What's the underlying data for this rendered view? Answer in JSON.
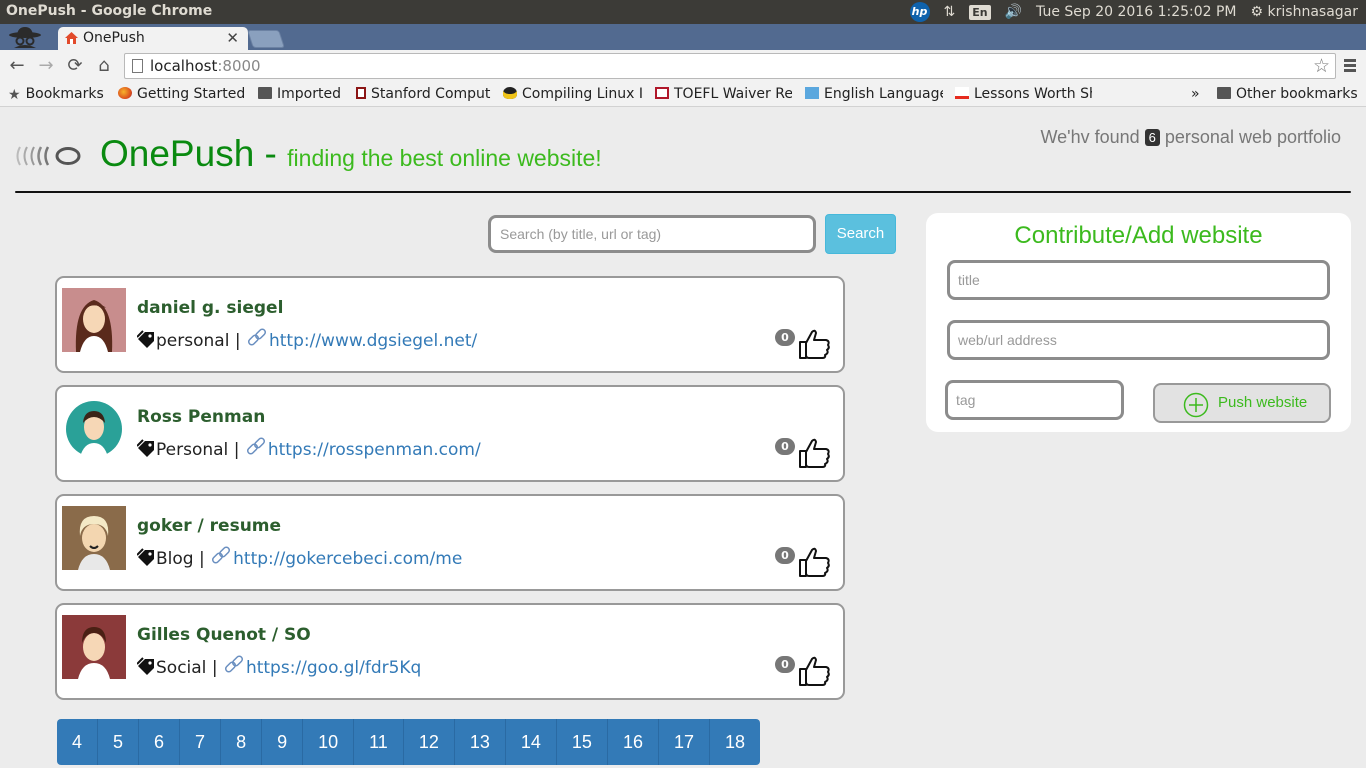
{
  "os": {
    "window_title": "OnePush - Google Chrome",
    "keyboard_layout": "En",
    "datetime": "Tue Sep 20 2016  1:25:02 PM",
    "username": "krishnasagar"
  },
  "browser": {
    "tab_title": "OnePush",
    "url_host": "localhost",
    "url_port": ":8000",
    "bookmarks": [
      {
        "label": "Bookmarks",
        "icon": "star-icon"
      },
      {
        "label": "Getting Started",
        "icon": "firefox-icon"
      },
      {
        "label": "Imported",
        "icon": "folder-icon"
      },
      {
        "label": "Stanford Comput",
        "icon": "stanford-icon"
      },
      {
        "label": "Compiling Linux I",
        "icon": "tux-icon"
      },
      {
        "label": "TOEFL Waiver Re",
        "icon": "toefl-icon"
      },
      {
        "label": "English Language",
        "icon": "ell-icon"
      },
      {
        "label": "Lessons Worth Sh",
        "icon": "ted-icon"
      }
    ],
    "overflow_chevron": "»",
    "other_bookmarks": "Other bookmarks"
  },
  "header": {
    "brand": "OnePush -",
    "tagline": "finding the best online website!",
    "found_prefix": "We'hv found",
    "found_count": "6",
    "found_suffix": "personal web portfolio"
  },
  "search": {
    "placeholder": "Search (by title, url or tag)",
    "button_label": "Search"
  },
  "sites": [
    {
      "name": "daniel g. siegel",
      "tag": "personal",
      "url": "http://www.dgsiegel.net/",
      "likes": "0",
      "avatar": "female-avatar"
    },
    {
      "name": "Ross Penman",
      "tag": "Personal",
      "url": "https://rosspenman.com/",
      "likes": "0",
      "avatar": "male-avatar-teal"
    },
    {
      "name": "goker / resume",
      "tag": "Blog",
      "url": "http://gokercebeci.com/me",
      "likes": "0",
      "avatar": "male-avatar-blond"
    },
    {
      "name": "Gilles Quenot / SO",
      "tag": "Social",
      "url": "https://goo.gl/fdr5Kq",
      "likes": "0",
      "avatar": "male-avatar-maroon"
    }
  ],
  "separator": "|",
  "contribute": {
    "heading": "Contribute/Add website",
    "title_placeholder": "title",
    "url_placeholder": "web/url address",
    "tag_placeholder": "tag",
    "push_label": "Push website"
  },
  "pagination": [
    "4",
    "5",
    "6",
    "7",
    "8",
    "9",
    "10",
    "11",
    "12",
    "13",
    "14",
    "15",
    "16",
    "17",
    "18"
  ]
}
